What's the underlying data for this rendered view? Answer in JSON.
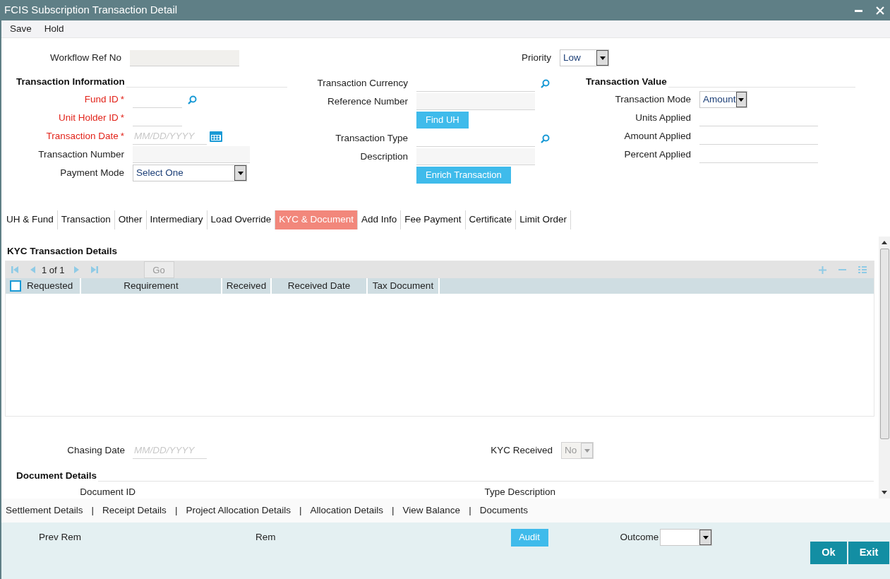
{
  "window": {
    "title": "FCIS Subscription Transaction Detail"
  },
  "menu": [
    {
      "label": "Save"
    },
    {
      "label": "Hold"
    }
  ],
  "required_mark": "*",
  "workflow_ref_no": {
    "label": "Workflow Ref No"
  },
  "priority": {
    "label": "Priority",
    "value": "Low"
  },
  "transaction_information": {
    "title": "Transaction Information",
    "fields": [
      {
        "kind": "lookup",
        "label": "Fund ID",
        "required": true
      },
      {
        "kind": "text",
        "label": "Unit Holder ID",
        "required": true
      },
      {
        "kind": "date",
        "label": "Transaction Date",
        "required": true,
        "placeholder": "MM/DD/YYYY"
      },
      {
        "kind": "readonly",
        "label": "Transaction Number",
        "required": false
      },
      {
        "kind": "select",
        "label": "Payment Mode",
        "required": false,
        "value": "Select One"
      }
    ]
  },
  "transaction_details": {
    "fields": [
      {
        "kind": "lookup",
        "label": "Transaction Currency"
      },
      {
        "kind": "readonly",
        "label": "Reference Number"
      },
      {
        "kind": "button",
        "label": "Find UH"
      },
      {
        "kind": "lookup",
        "label": "Transaction Type"
      },
      {
        "kind": "readonly",
        "label": "Description"
      },
      {
        "kind": "button",
        "label": "Enrich Transaction"
      }
    ]
  },
  "transaction_value": {
    "title": "Transaction Value",
    "fields": [
      {
        "kind": "select",
        "label": "Transaction Mode",
        "value": "Amount"
      },
      {
        "kind": "text",
        "label": "Units Applied"
      },
      {
        "kind": "text",
        "label": "Amount Applied"
      },
      {
        "kind": "text",
        "label": "Percent Applied"
      }
    ]
  },
  "tabs": [
    {
      "label": "UH & Fund",
      "selected": false
    },
    {
      "label": "Transaction",
      "selected": false
    },
    {
      "label": "Other",
      "selected": false
    },
    {
      "label": "Intermediary",
      "selected": false
    },
    {
      "label": "Load Override",
      "selected": false
    },
    {
      "label": "KYC & Document",
      "selected": true
    },
    {
      "label": "Add Info",
      "selected": false
    },
    {
      "label": "Fee Payment",
      "selected": false
    },
    {
      "label": "Certificate",
      "selected": false
    },
    {
      "label": "Limit Order",
      "selected": false
    }
  ],
  "kyc_transaction_details": {
    "title": "KYC Transaction Details",
    "pager": {
      "current": "1",
      "of": "of",
      "total": "1"
    },
    "go": "Go",
    "select_all_checked": false,
    "columns": [
      "Requested",
      "Requirement",
      "Received",
      "Received Date",
      "Tax Document"
    ]
  },
  "chasing_date": {
    "label": "Chasing Date",
    "placeholder": "MM/DD/YYYY"
  },
  "kyc_received": {
    "label": "KYC Received",
    "value": "No",
    "disabled": true
  },
  "document_details": {
    "title": "Document Details",
    "columns": [
      "Document ID",
      "Type Description"
    ]
  },
  "links": [
    {
      "label": "Settlement Details"
    },
    {
      "label": "Receipt Details"
    },
    {
      "label": "Project Allocation Details"
    },
    {
      "label": "Allocation Details"
    },
    {
      "label": "View Balance"
    },
    {
      "label": "Documents"
    }
  ],
  "link_separator": "|",
  "footer": {
    "prev_rem": "Prev Rem",
    "rem": "Rem",
    "audit": "Audit",
    "outcome": {
      "label": "Outcome"
    },
    "buttons": [
      {
        "label": "Ok"
      },
      {
        "label": "Exit"
      }
    ]
  }
}
